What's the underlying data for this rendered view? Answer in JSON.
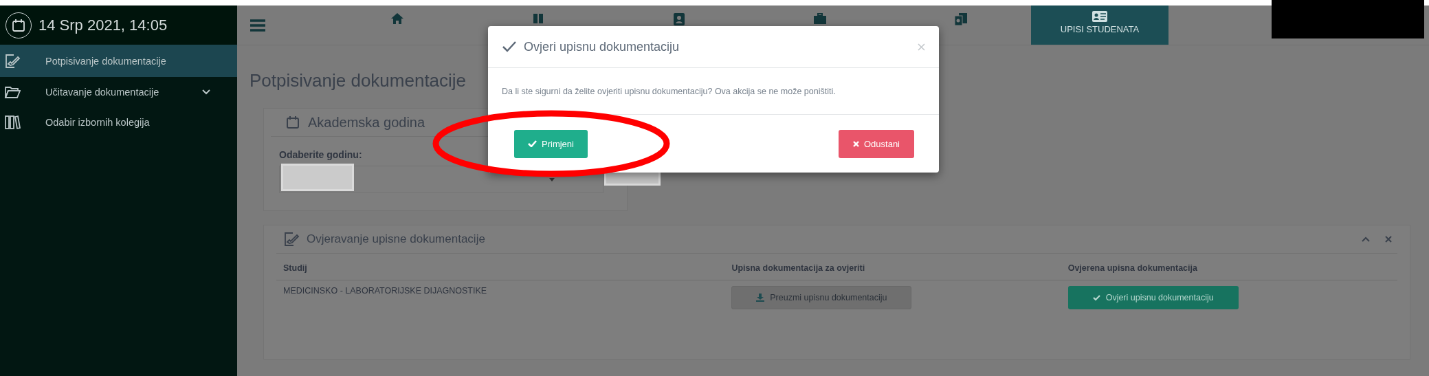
{
  "sidebar": {
    "date": "14 Srp 2021, 14:05",
    "items": [
      {
        "label": "Potpisivanje dokumentacije",
        "kind": "sign",
        "selected": true,
        "expandable": false
      },
      {
        "label": "Učitavanje dokumentacije",
        "kind": "folder",
        "selected": false,
        "expandable": true
      },
      {
        "label": "Odabir izbornih kolegija",
        "kind": "books",
        "selected": false,
        "expandable": false
      }
    ]
  },
  "navbar": {
    "tabs": [
      {
        "kind": "home",
        "selected": false
      },
      {
        "kind": "book",
        "selected": false
      },
      {
        "kind": "badge",
        "selected": false
      },
      {
        "kind": "briefcase",
        "selected": false
      },
      {
        "kind": "docs",
        "selected": false
      },
      {
        "kind": "idcard",
        "label": "UPISI STUDENATA",
        "selected": true
      }
    ]
  },
  "page_title": "Potpisivanje dokumentacije",
  "year_card": {
    "title": "Akademska godina",
    "field_label": "Odaberite godinu:"
  },
  "verify_card": {
    "title": "Ovjeravanje upisne dokumentacije",
    "columns": [
      "Studij",
      "Upisna dokumentacija za ovjeriti",
      "Ovjerena upisna dokumentacija"
    ],
    "rows": [
      {
        "study": "MEDICINSKO - LABORATORIJSKE DIJAGNOSTIKE",
        "download_button": "Preuzmi upisnu dokumentaciju",
        "verify_button": "Ovjeri upisnu dokumentaciju"
      }
    ]
  },
  "dialog": {
    "title": "Ovjeri upisnu dokumentaciju",
    "message": "Da li ste sigurni da želite ovjeriti upisnu dokumentaciju? Ova akcija se ne može poništiti.",
    "confirm": "Primjeni",
    "cancel": "Odustani"
  }
}
